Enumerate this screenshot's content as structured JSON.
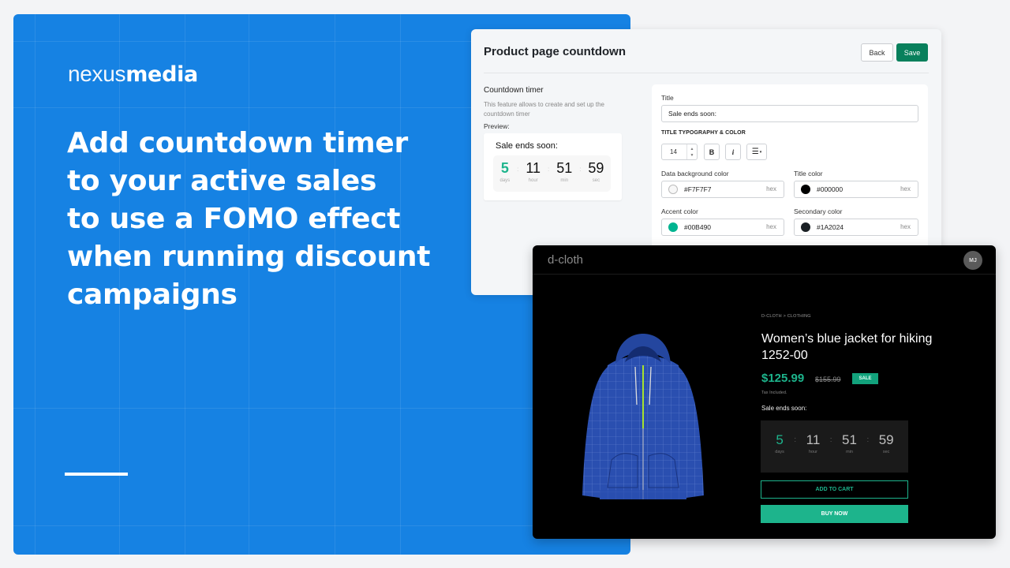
{
  "hero": {
    "logo_light": "nexus",
    "logo_bold": "media",
    "headline_lines": [
      "Add countdown timer",
      "to your active sales",
      "to use a FOMO effect",
      "when running discount",
      "campaigns"
    ],
    "background_color": "#1682E3"
  },
  "settings": {
    "title": "Product page countdown",
    "back_label": "Back",
    "save_label": "Save",
    "section_title": "Countdown timer",
    "section_desc": "This feature allows to create and set up the countdown timer",
    "preview_label": "Preview:",
    "preview": {
      "title": "Sale ends soon:",
      "units": [
        {
          "value": "5",
          "label": "days"
        },
        {
          "value": "11",
          "label": "hour"
        },
        {
          "value": "51",
          "label": "min"
        },
        {
          "value": "59",
          "label": "sec"
        }
      ]
    },
    "form": {
      "title_label": "Title",
      "title_value": "Sale ends soon:",
      "typography_heading": "TITLE TYPOGRAPHY & COLOR",
      "font_size": "14",
      "bold_label": "B",
      "italic_label": "i",
      "align_icon": "align-left-icon",
      "colors": [
        {
          "label": "Data background color",
          "value": "#F7F7F7",
          "unit": "hex",
          "swatch": "#F7F7F7"
        },
        {
          "label": "Title color",
          "value": "#000000",
          "unit": "hex",
          "swatch": "#000000"
        },
        {
          "label": "Accent color",
          "value": "#00B490",
          "unit": "hex",
          "swatch": "#00B490"
        },
        {
          "label": "Secondary color",
          "value": "#1A2024",
          "unit": "hex",
          "swatch": "#1A2024"
        }
      ]
    },
    "save_color": "#08805C"
  },
  "store": {
    "brand": "d-cloth",
    "avatar_initials": "MJ",
    "breadcrumb": "D-CLOTH > CLOTHING",
    "product_title": "Women’s blue jacket for hiking 1252-00",
    "price": "$125.99",
    "old_price": "$155.99",
    "sale_badge": "SALE",
    "tax_note": "Tax Included.",
    "countdown_label": "Sale ends soon:",
    "countdown": [
      {
        "value": "5",
        "label": "days"
      },
      {
        "value": "11",
        "label": "hour"
      },
      {
        "value": "51",
        "label": "min"
      },
      {
        "value": "59",
        "label": "sec"
      }
    ],
    "add_to_cart_label": "ADD TO CART",
    "buy_now_label": "BUY NOW",
    "product_image": "blue-hoodie-jacket-image",
    "accent_color": "#1DB48C"
  }
}
